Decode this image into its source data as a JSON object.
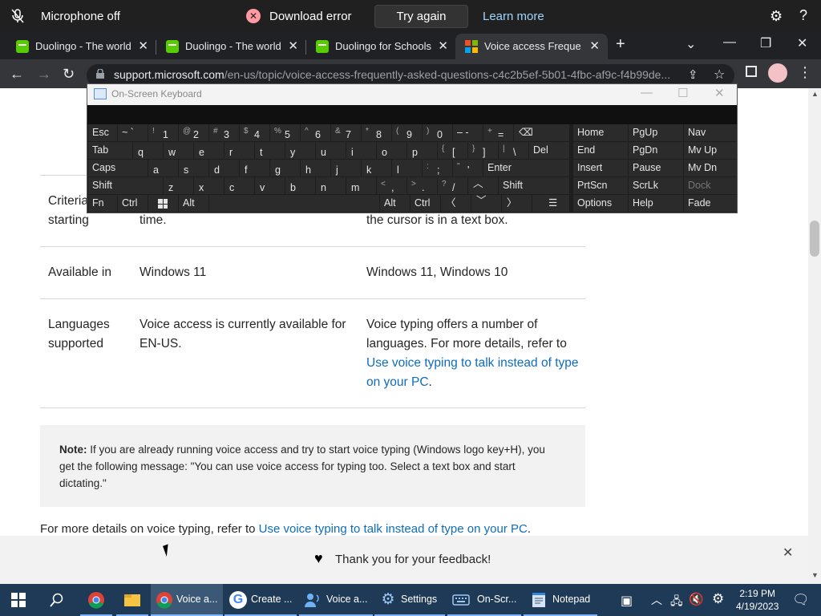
{
  "voice_bar": {
    "mic_status": "Microphone off",
    "error": "Download error",
    "try_again": "Try again",
    "learn_more": "Learn more"
  },
  "tabs": [
    {
      "title": "Duolingo - The world's",
      "active": false
    },
    {
      "title": "Duolingo - The world's",
      "active": false
    },
    {
      "title": "Duolingo for Schools",
      "active": false
    },
    {
      "title": "Voice access Frequently",
      "active": true
    }
  ],
  "address": {
    "host": "support.microsoft.com",
    "path": "/en-us/topic/voice-access-frequently-asked-questions-c4c2b5ef-5b01-4fbc-af9c-f4b99de..."
  },
  "table": {
    "rows": [
      {
        "label": "Criteria for starting",
        "col1": "time.",
        "col2": "the cursor is in a text box."
      },
      {
        "label": "Available in",
        "col1": "Windows 11",
        "col2": "Windows 11, Windows 10"
      },
      {
        "label": "Languages supported",
        "col1": "Voice access is currently available for EN-US.",
        "col2_text": "Voice typing offers a number of languages. For more details, refer to",
        "col2_link": "Use voice typing to talk instead of type on your PC",
        "col2_end": "."
      }
    ]
  },
  "note": {
    "label": "Note:",
    "text": "If you are already running voice access and try to start voice typing (Windows logo key+H), you get the following message: \"You can use voice access for typing too. Select a text box and start dictating.\""
  },
  "more": {
    "prefix": "For more details on voice typing, refer to",
    "link": "Use voice typing to talk instead of type on your PC",
    "suffix": "."
  },
  "feedback": {
    "message": "Thank you for your feedback!"
  },
  "osk": {
    "title": "On-Screen Keyboard",
    "side_keys": [
      [
        "Home",
        "PgUp",
        "Nav"
      ],
      [
        "End",
        "PgDn",
        "Mv Up"
      ],
      [
        "Insert",
        "Pause",
        "Mv Dn"
      ],
      [
        "PrtScn",
        "ScrLk",
        "Dock"
      ],
      [
        "Options",
        "Help",
        "Fade"
      ]
    ],
    "mod_labels": {
      "esc": "Esc",
      "tab": "Tab",
      "caps": "Caps",
      "shift": "Shift",
      "fn": "Fn",
      "ctrl": "Ctrl",
      "alt": "Alt",
      "del": "Del",
      "enter": "Enter"
    }
  },
  "taskbar": {
    "items": [
      {
        "label": "Voice a..."
      },
      {
        "label": "Create ..."
      },
      {
        "label": "Voice a..."
      },
      {
        "label": "Settings"
      },
      {
        "label": "On-Scr..."
      },
      {
        "label": "Notepad"
      }
    ],
    "time": "2:19 PM",
    "date": "4/19/2023"
  }
}
